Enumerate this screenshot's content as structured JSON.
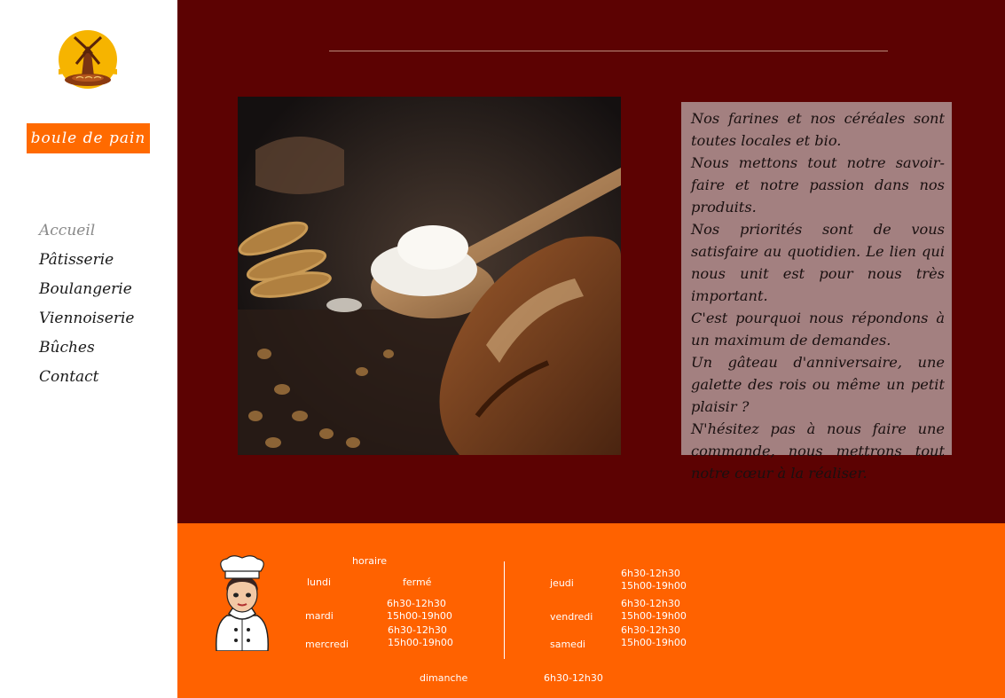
{
  "sidebar": {
    "brand": "boule de pain",
    "nav": [
      {
        "label": "Accueil",
        "active": true
      },
      {
        "label": "Pâtisserie"
      },
      {
        "label": "Boulangerie"
      },
      {
        "label": "Viennoiserie"
      },
      {
        "label": "Bûches"
      },
      {
        "label": "Contact"
      }
    ]
  },
  "main": {
    "paragraphs": [
      "Nos farines et nos céréales sont toutes locales et bio.",
      "Nous mettons tout notre savoir-faire et notre passion dans nos produits.",
      "Nos priorités sont de vous satisfaire au quotidien. Le lien qui nous unit est pour nous très important.",
      "C'est pourquoi nous répondons à un maximum de demandes.",
      "Un gâteau d'anniversaire, une galette des rois ou même un petit plaisir ?",
      "N'hésitez pas à nous faire une commande, nous mettrons tout notre cœur à la réaliser."
    ]
  },
  "footer": {
    "title": "horaire",
    "days": {
      "lundi": {
        "day": "lundi",
        "hours": "fermé"
      },
      "mardi": {
        "day": "mardi",
        "morning": "6h30-12h30",
        "afternoon": "15h00-19h00"
      },
      "mercredi": {
        "day": "mercredi",
        "morning": "6h30-12h30",
        "afternoon": "15h00-19h00"
      },
      "jeudi": {
        "day": "jeudi",
        "morning": "6h30-12h30",
        "afternoon": "15h00-19h00"
      },
      "vendredi": {
        "day": "vendredi",
        "morning": "6h30-12h30",
        "afternoon": "15h00-19h00"
      },
      "samedi": {
        "day": "samedi",
        "morning": "6h30-12h30",
        "afternoon": "15h00-19h00"
      },
      "dimanche": {
        "day": "dimanche",
        "hours": "6h30-12h30"
      }
    }
  },
  "colors": {
    "accent": "#ff6200",
    "main_bg": "#5c0202",
    "textbox_bg": "#a38080"
  },
  "icons": [
    "windmill-logo-icon",
    "chef-illustration"
  ]
}
